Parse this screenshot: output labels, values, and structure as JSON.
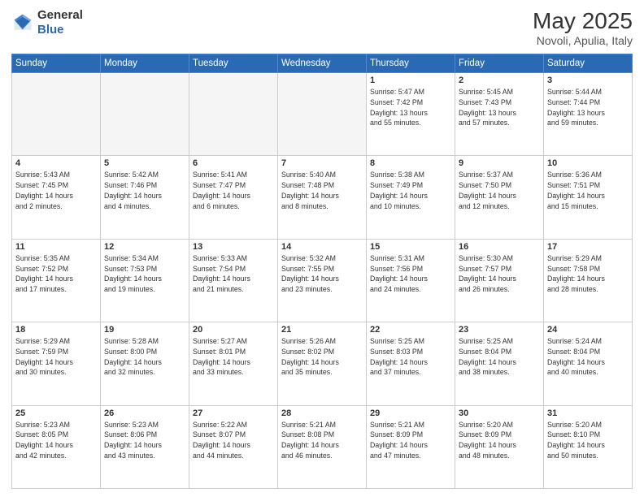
{
  "header": {
    "logo_line1": "General",
    "logo_line2": "Blue",
    "title": "May 2025",
    "location": "Novoli, Apulia, Italy"
  },
  "weekdays": [
    "Sunday",
    "Monday",
    "Tuesday",
    "Wednesday",
    "Thursday",
    "Friday",
    "Saturday"
  ],
  "weeks": [
    [
      {
        "day": "",
        "info": ""
      },
      {
        "day": "",
        "info": ""
      },
      {
        "day": "",
        "info": ""
      },
      {
        "day": "",
        "info": ""
      },
      {
        "day": "1",
        "info": "Sunrise: 5:47 AM\nSunset: 7:42 PM\nDaylight: 13 hours\nand 55 minutes."
      },
      {
        "day": "2",
        "info": "Sunrise: 5:45 AM\nSunset: 7:43 PM\nDaylight: 13 hours\nand 57 minutes."
      },
      {
        "day": "3",
        "info": "Sunrise: 5:44 AM\nSunset: 7:44 PM\nDaylight: 13 hours\nand 59 minutes."
      }
    ],
    [
      {
        "day": "4",
        "info": "Sunrise: 5:43 AM\nSunset: 7:45 PM\nDaylight: 14 hours\nand 2 minutes."
      },
      {
        "day": "5",
        "info": "Sunrise: 5:42 AM\nSunset: 7:46 PM\nDaylight: 14 hours\nand 4 minutes."
      },
      {
        "day": "6",
        "info": "Sunrise: 5:41 AM\nSunset: 7:47 PM\nDaylight: 14 hours\nand 6 minutes."
      },
      {
        "day": "7",
        "info": "Sunrise: 5:40 AM\nSunset: 7:48 PM\nDaylight: 14 hours\nand 8 minutes."
      },
      {
        "day": "8",
        "info": "Sunrise: 5:38 AM\nSunset: 7:49 PM\nDaylight: 14 hours\nand 10 minutes."
      },
      {
        "day": "9",
        "info": "Sunrise: 5:37 AM\nSunset: 7:50 PM\nDaylight: 14 hours\nand 12 minutes."
      },
      {
        "day": "10",
        "info": "Sunrise: 5:36 AM\nSunset: 7:51 PM\nDaylight: 14 hours\nand 15 minutes."
      }
    ],
    [
      {
        "day": "11",
        "info": "Sunrise: 5:35 AM\nSunset: 7:52 PM\nDaylight: 14 hours\nand 17 minutes."
      },
      {
        "day": "12",
        "info": "Sunrise: 5:34 AM\nSunset: 7:53 PM\nDaylight: 14 hours\nand 19 minutes."
      },
      {
        "day": "13",
        "info": "Sunrise: 5:33 AM\nSunset: 7:54 PM\nDaylight: 14 hours\nand 21 minutes."
      },
      {
        "day": "14",
        "info": "Sunrise: 5:32 AM\nSunset: 7:55 PM\nDaylight: 14 hours\nand 23 minutes."
      },
      {
        "day": "15",
        "info": "Sunrise: 5:31 AM\nSunset: 7:56 PM\nDaylight: 14 hours\nand 24 minutes."
      },
      {
        "day": "16",
        "info": "Sunrise: 5:30 AM\nSunset: 7:57 PM\nDaylight: 14 hours\nand 26 minutes."
      },
      {
        "day": "17",
        "info": "Sunrise: 5:29 AM\nSunset: 7:58 PM\nDaylight: 14 hours\nand 28 minutes."
      }
    ],
    [
      {
        "day": "18",
        "info": "Sunrise: 5:29 AM\nSunset: 7:59 PM\nDaylight: 14 hours\nand 30 minutes."
      },
      {
        "day": "19",
        "info": "Sunrise: 5:28 AM\nSunset: 8:00 PM\nDaylight: 14 hours\nand 32 minutes."
      },
      {
        "day": "20",
        "info": "Sunrise: 5:27 AM\nSunset: 8:01 PM\nDaylight: 14 hours\nand 33 minutes."
      },
      {
        "day": "21",
        "info": "Sunrise: 5:26 AM\nSunset: 8:02 PM\nDaylight: 14 hours\nand 35 minutes."
      },
      {
        "day": "22",
        "info": "Sunrise: 5:25 AM\nSunset: 8:03 PM\nDaylight: 14 hours\nand 37 minutes."
      },
      {
        "day": "23",
        "info": "Sunrise: 5:25 AM\nSunset: 8:04 PM\nDaylight: 14 hours\nand 38 minutes."
      },
      {
        "day": "24",
        "info": "Sunrise: 5:24 AM\nSunset: 8:04 PM\nDaylight: 14 hours\nand 40 minutes."
      }
    ],
    [
      {
        "day": "25",
        "info": "Sunrise: 5:23 AM\nSunset: 8:05 PM\nDaylight: 14 hours\nand 42 minutes."
      },
      {
        "day": "26",
        "info": "Sunrise: 5:23 AM\nSunset: 8:06 PM\nDaylight: 14 hours\nand 43 minutes."
      },
      {
        "day": "27",
        "info": "Sunrise: 5:22 AM\nSunset: 8:07 PM\nDaylight: 14 hours\nand 44 minutes."
      },
      {
        "day": "28",
        "info": "Sunrise: 5:21 AM\nSunset: 8:08 PM\nDaylight: 14 hours\nand 46 minutes."
      },
      {
        "day": "29",
        "info": "Sunrise: 5:21 AM\nSunset: 8:09 PM\nDaylight: 14 hours\nand 47 minutes."
      },
      {
        "day": "30",
        "info": "Sunrise: 5:20 AM\nSunset: 8:09 PM\nDaylight: 14 hours\nand 48 minutes."
      },
      {
        "day": "31",
        "info": "Sunrise: 5:20 AM\nSunset: 8:10 PM\nDaylight: 14 hours\nand 50 minutes."
      }
    ]
  ]
}
